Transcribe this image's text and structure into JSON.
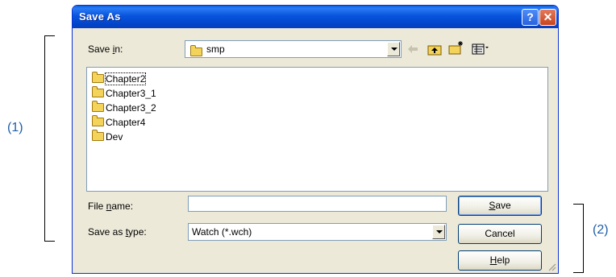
{
  "annotations": {
    "callout_1": "(1)",
    "callout_2": "(2)"
  },
  "window": {
    "title": "Save As",
    "help_label": "?",
    "close_label": "✕"
  },
  "save_in": {
    "label_before": "Save ",
    "label_accel": "i",
    "label_after": "n:",
    "value": "smp",
    "icon": "folder-icon"
  },
  "toolbar": {
    "back_icon": "back-arrow-icon",
    "up_icon": "up-one-level-icon",
    "new_folder_icon": "new-folder-icon",
    "view_icon": "view-menu-icon"
  },
  "files": [
    {
      "name": "Chapter2",
      "icon": "folder-icon"
    },
    {
      "name": "Chapter3_1",
      "icon": "folder-icon"
    },
    {
      "name": "Chapter3_2",
      "icon": "folder-icon"
    },
    {
      "name": "Chapter4",
      "icon": "folder-icon"
    },
    {
      "name": "Dev",
      "icon": "folder-icon"
    }
  ],
  "file_name": {
    "label_before": "File ",
    "label_accel": "n",
    "label_after": "ame:",
    "value": ""
  },
  "save_as_type": {
    "label_before": "Save as ",
    "label_accel": "t",
    "label_after": "ype:",
    "value": "Watch (*.wch)"
  },
  "buttons": {
    "save_accel": "S",
    "save_rest": "ave",
    "cancel": "Cancel",
    "help_accel": "H",
    "help_rest": "elp"
  },
  "colors": {
    "titlebar": "#0a5fe0",
    "callout": "#1f5ea8",
    "dialog_bg": "#ece9d8"
  }
}
